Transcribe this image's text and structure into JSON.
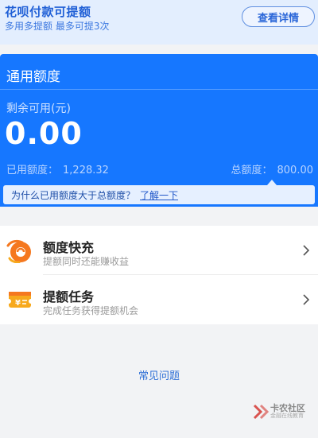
{
  "promo": {
    "title": "花呗付款可提额",
    "subtitle": "多用多提额 最多可提3次",
    "button": "查看详情"
  },
  "credit": {
    "title": "通用额度",
    "remain_label": "剩余可用(元)",
    "remain_value": "0.00",
    "used_label": "已用额度：",
    "used_value": "1,228.32",
    "total_label": "总额度：",
    "total_value": "800.00",
    "notice_text": "为什么已用额度大于总额度？",
    "notice_link": "了解一下"
  },
  "list": {
    "items": [
      {
        "title": "额度快充",
        "subtitle": "提额同时还能赚收益",
        "icon": "quick-charge-icon"
      },
      {
        "title": "提额任务",
        "subtitle": "完成任务获得提额机会",
        "icon": "task-ticket-icon"
      }
    ]
  },
  "faq": "常见问题",
  "watermark": {
    "title": "卡农社区",
    "subtitle": "金融在线教育"
  },
  "colors": {
    "accent": "#1677ff",
    "banner": "#e3eefe",
    "icon_orange": "#f5781f",
    "icon_yellow": "#f7a91d"
  }
}
